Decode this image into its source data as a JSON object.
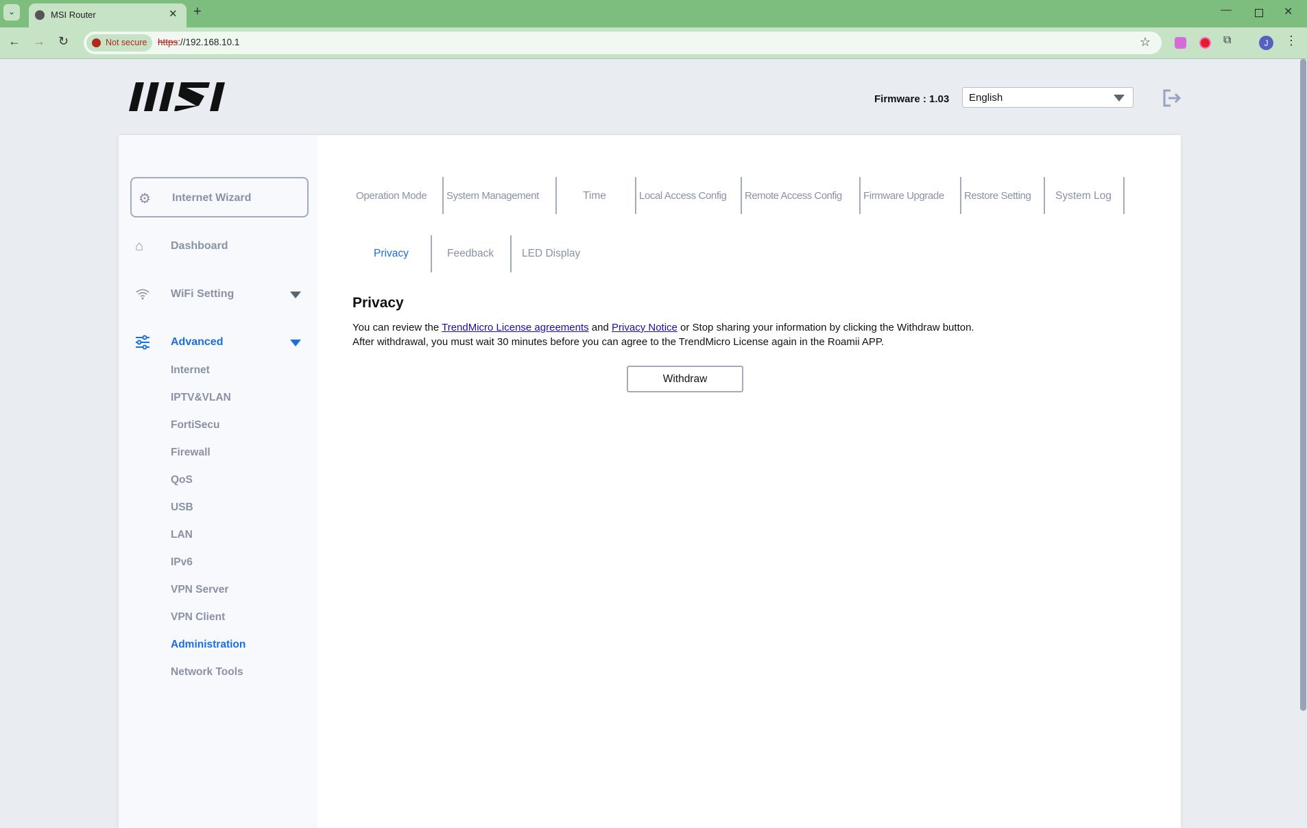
{
  "browser": {
    "tab_title": "MSI Router",
    "not_secure": "Not secure",
    "url_scheme": "https",
    "url_rest": "://192.168.10.1",
    "profile_initial": "J"
  },
  "header": {
    "brand": "MSI",
    "firmware": "Firmware : 1.03",
    "language": "English"
  },
  "sidebar": {
    "wizard": "Internet Wizard",
    "dashboard": "Dashboard",
    "wifi": "WiFi Setting",
    "advanced": "Advanced",
    "sub": [
      "Internet",
      "IPTV&VLAN",
      "FortiSecu",
      "Firewall",
      "QoS",
      "USB",
      "LAN",
      "IPv6",
      "VPN Server",
      "VPN Client",
      "Administration",
      "Network Tools"
    ],
    "active_sub": "Administration"
  },
  "tabs": [
    "Operation Mode",
    "System Management",
    "Time",
    "Local Access Config",
    "Remote Access Config",
    "Firmware Upgrade",
    "Restore Setting",
    "System Log"
  ],
  "subtabs": [
    "Privacy",
    "Feedback",
    "LED Display"
  ],
  "content": {
    "title": "Privacy",
    "p1a": "You can review the ",
    "link1": "TrendMicro License agreements",
    "p1b": " and ",
    "link2": "Privacy Notice",
    "p1c": " or Stop sharing your information by clicking the Withdraw button.",
    "p2": "After withdrawal, you must wait 30 minutes before you can agree to the TrendMicro License again in the Roamii APP.",
    "button": "Withdraw"
  },
  "colors": {
    "accent": "#1a6fe0",
    "chrome": "#7dbd7e"
  }
}
